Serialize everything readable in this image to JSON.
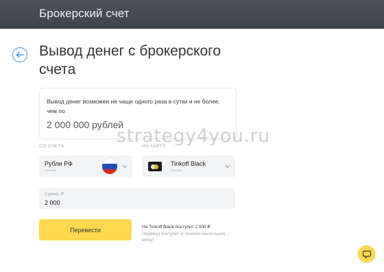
{
  "header": {
    "title": "Брокерский счет"
  },
  "page": {
    "title": "Вывод денег с брокерского счета"
  },
  "info": {
    "text": "Вывод денег возможен не чаще одного раза в сутки и не более, чем по",
    "amount": "2 000 000 рублей"
  },
  "from_account": {
    "label": "СО СЧЕТА",
    "title": "Рубли РФ",
    "subtitle": "••••••",
    "flag_colors": [
      "#ffffff",
      "#1f4fb8",
      "#d52b1e"
    ]
  },
  "to_card": {
    "label": "НА КАРТУ",
    "title": "Tinkoff Black",
    "subtitle": "••••••"
  },
  "amount": {
    "label": "Сумма, ₽",
    "value": "2 000"
  },
  "actions": {
    "submit_label": "Перевести"
  },
  "notes": {
    "received": "На Tinkoff Black поступит 2 000 ₽",
    "timing": "Перевод поступит в течение нескольких минут"
  },
  "watermark": "strategy4you.ru",
  "icons": {
    "back": "arrow-left-icon",
    "chat": "chat-icon",
    "chevron": "chevron-down-icon"
  },
  "colors": {
    "accent": "#fcd94e",
    "link": "#3f8ed6",
    "header": "#444950"
  }
}
